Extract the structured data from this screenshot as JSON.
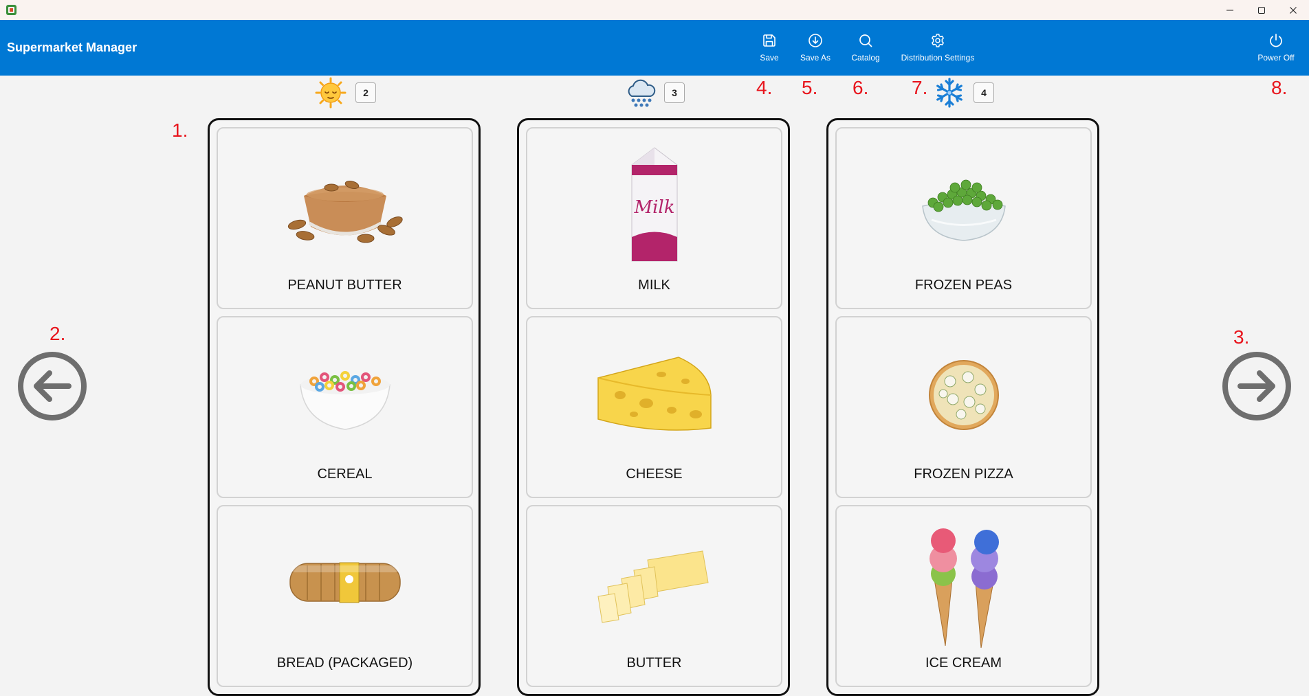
{
  "window": {
    "minimize_icon": "minimize-icon",
    "maximize_icon": "maximize-icon",
    "close_icon": "close-icon"
  },
  "header": {
    "app_title": "Supermarket Manager",
    "toolbar": {
      "save_label": "Save",
      "save_as_label": "Save As",
      "catalog_label": "Catalog",
      "distribution_settings_label": "Distribution Settings",
      "power_off_label": "Power Off"
    },
    "background_color": "#0078d4"
  },
  "annotations": [
    "1.",
    "2.",
    "3.",
    "4.",
    "5.",
    "6.",
    "7.",
    "8."
  ],
  "annotation_color": "#e8141c",
  "zones": [
    {
      "icon": "sun-icon",
      "count": "2",
      "items": [
        {
          "label": "PEANUT BUTTER",
          "icon": "peanut-butter-icon"
        },
        {
          "label": "CEREAL",
          "icon": "cereal-icon"
        },
        {
          "label": "BREAD (PACKAGED)",
          "icon": "bread-icon"
        }
      ]
    },
    {
      "icon": "cloud-rain-icon",
      "count": "3",
      "items": [
        {
          "label": "MILK",
          "icon": "milk-icon",
          "carton_text": "Milk"
        },
        {
          "label": "CHEESE",
          "icon": "cheese-icon"
        },
        {
          "label": "BUTTER",
          "icon": "butter-icon"
        }
      ]
    },
    {
      "icon": "snowflake-icon",
      "count": "4",
      "items": [
        {
          "label": "FROZEN PEAS",
          "icon": "peas-icon"
        },
        {
          "label": "FROZEN PIZZA",
          "icon": "pizza-icon"
        },
        {
          "label": "ICE CREAM",
          "icon": "ice-cream-icon"
        }
      ]
    }
  ],
  "navigation": {
    "previous_icon": "arrow-left-circle-icon",
    "next_icon": "arrow-right-circle-icon"
  }
}
